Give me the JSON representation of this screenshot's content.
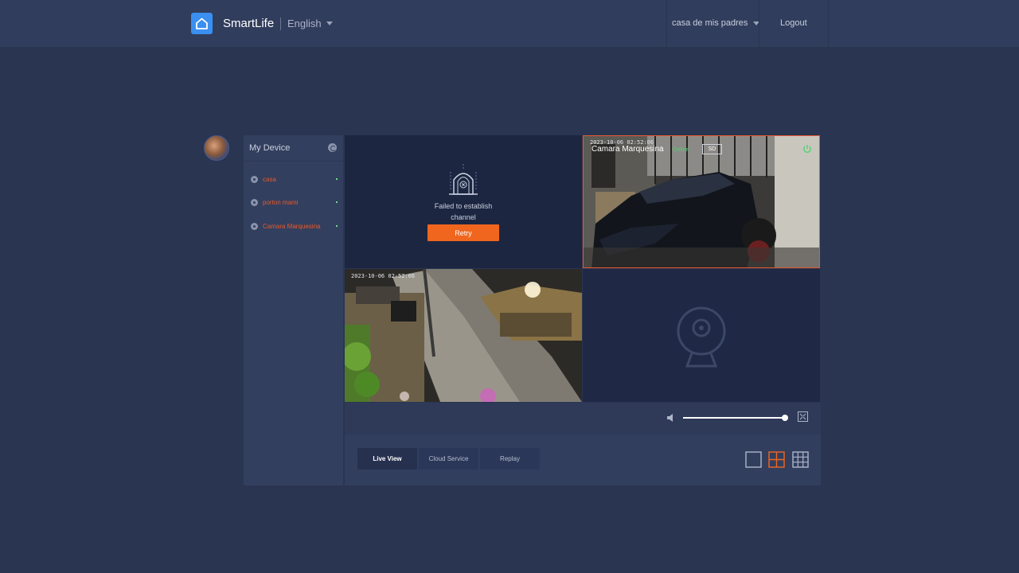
{
  "header": {
    "brand": "SmartLife",
    "language": "English",
    "home": "casa de mis padres",
    "logout": "Logout"
  },
  "sidebar": {
    "title": "My Device",
    "devices": [
      {
        "name": "casa"
      },
      {
        "name": "porton mami"
      },
      {
        "name": "Camara Marquesina"
      }
    ]
  },
  "cells": {
    "channel1": {
      "error": "Failed to establish channel",
      "retry": "Retry"
    },
    "channel2": {
      "timestamp": "2023-10-06 02:52:06",
      "name": "Camara Marquesina",
      "status": "Online",
      "quality": "SD"
    },
    "channel3": {
      "timestamp": "2023-10-06 02:52:06"
    }
  },
  "tabs": {
    "live": "Live View",
    "cloud": "Cloud Service",
    "replay": "Replay"
  },
  "colors": {
    "accent": "#f0661e",
    "online": "#45d66b",
    "background": "#2a3552"
  },
  "controls": {
    "volume_fraction": 1.0
  }
}
